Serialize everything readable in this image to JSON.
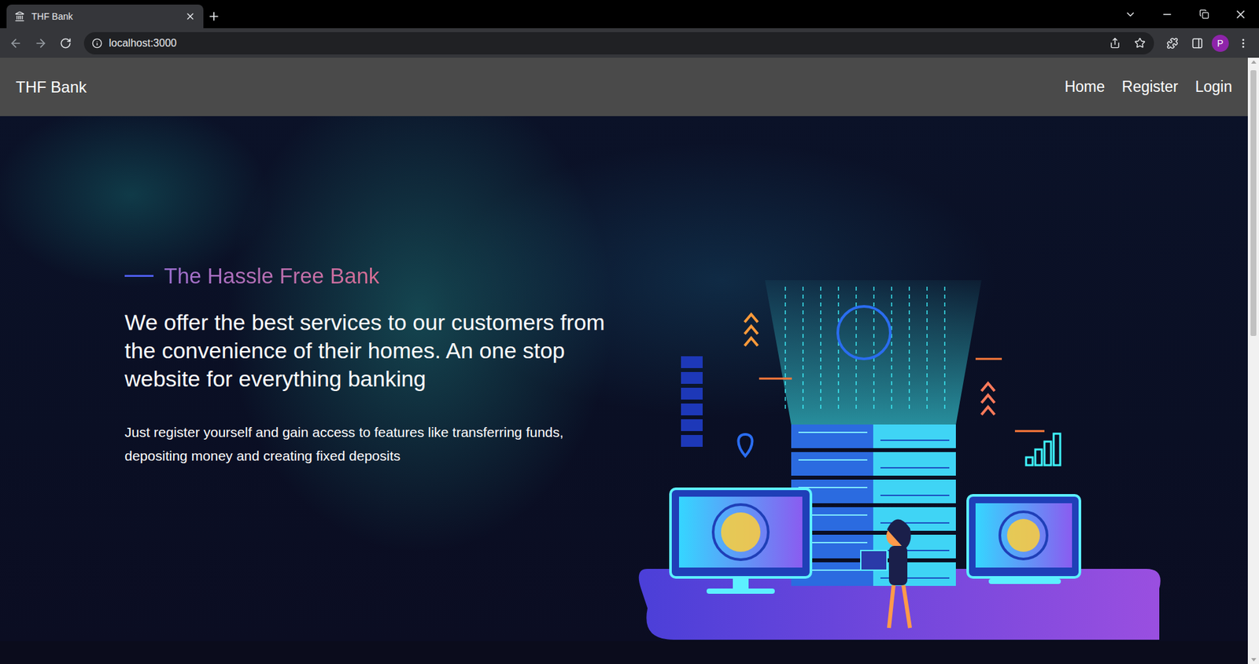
{
  "browser": {
    "tabs": [
      {
        "title": "THF Bank",
        "selected": true
      }
    ],
    "address": "localhost:3000",
    "profile": "P"
  },
  "navbar": {
    "brand": "THF Bank",
    "links": [
      {
        "label": "Home"
      },
      {
        "label": "Register"
      },
      {
        "label": "Login"
      }
    ]
  },
  "hero": {
    "tagline": "The Hassle Free Bank",
    "heading": "We offer the best services to our customers from the convenience of their homes. An one stop website for everything banking",
    "text": "Just register yourself and gain access to features like transferring funds, depositing money and creating fixed deposits"
  }
}
